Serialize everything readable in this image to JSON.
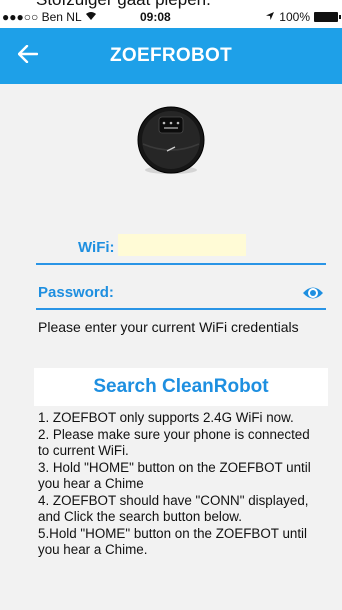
{
  "caption": "Stofzuiger gaat piepen.",
  "status": {
    "carrier": "Ben NL",
    "signal": "●●●○○",
    "time": "09:08",
    "battery": "100%"
  },
  "nav": {
    "title": "ZOEFROBOT",
    "back_icon": "arrow-left-icon"
  },
  "form": {
    "wifi_label": "WiFi:",
    "wifi_value": "",
    "password_label": "Password:",
    "password_value": "",
    "show_password_icon": "eye-icon",
    "hint": "Please enter your current WiFi credentials"
  },
  "search_button": "Search CleanRobot",
  "instructions": [
    "1. ZOEFBOT only supports 2.4G WiFi now.",
    "2. Please make sure your phone is connected to current WiFi.",
    "3. Hold \"HOME\" button on the ZOEFBOT until you hear a Chime",
    "4. ZOEFBOT should have \"CONN\" displayed, and Click the search button below.",
    "5.Hold \"HOME\" button on the ZOEFBOT until you hear a Chime."
  ],
  "colors": {
    "accent": "#1ea0e8",
    "label": "#1e8fe0",
    "background": "#f2f2f2"
  }
}
